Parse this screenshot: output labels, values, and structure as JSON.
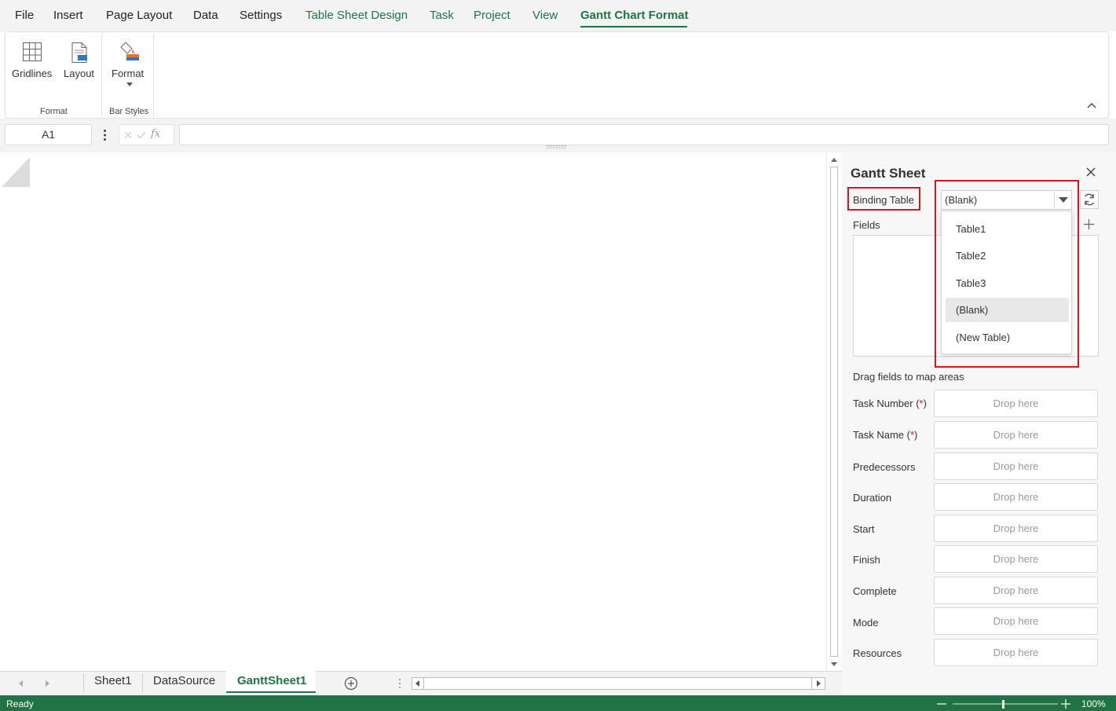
{
  "menu": {
    "items": [
      "File",
      "Insert",
      "Page Layout",
      "Data",
      "Settings",
      "Table Sheet Design",
      "Task",
      "Project",
      "View",
      "Gantt Chart Format"
    ],
    "active": "Gantt Chart Format"
  },
  "ribbon": {
    "gridlines_label": "Gridlines",
    "layout_label": "Layout",
    "format_label": "Format",
    "group_format": "Format",
    "group_bar_styles": "Bar Styles"
  },
  "formula_bar": {
    "cell_ref": "A1",
    "fx": "fx",
    "value": ""
  },
  "panel": {
    "title": "Gantt Sheet",
    "binding_table_label": "Binding Table",
    "binding_table_value": "(Blank)",
    "fields_label": "Fields",
    "drag_hint": "Drag fields to map areas",
    "drop_placeholder": "Drop here",
    "required_mark": "*",
    "mappings": [
      {
        "label": "Task Number",
        "required": true
      },
      {
        "label": "Task Name",
        "required": true
      },
      {
        "label": "Predecessors",
        "required": false
      },
      {
        "label": "Duration",
        "required": false
      },
      {
        "label": "Start",
        "required": false
      },
      {
        "label": "Finish",
        "required": false
      },
      {
        "label": "Complete",
        "required": false
      },
      {
        "label": "Mode",
        "required": false
      },
      {
        "label": "Resources",
        "required": false
      }
    ]
  },
  "dropdown": {
    "options": [
      "Table1",
      "Table2",
      "Table3",
      "(Blank)",
      "(New Table)"
    ],
    "selected": "(Blank)"
  },
  "sheet_tabs": {
    "tabs": [
      "Sheet1",
      "DataSource",
      "GanttSheet1"
    ],
    "active": "GanttSheet1"
  },
  "status": {
    "text": "Ready",
    "zoom": "100%"
  },
  "colors": {
    "accent": "#217346",
    "highlight": "#e0141e"
  }
}
